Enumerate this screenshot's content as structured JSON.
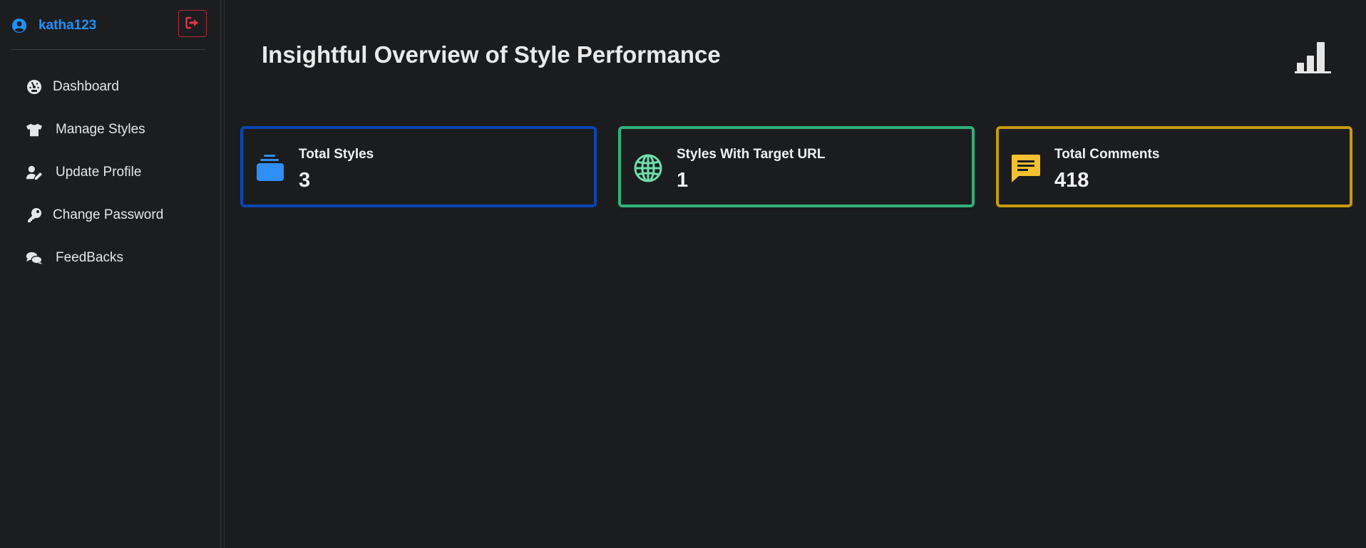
{
  "user": {
    "username": "katha123"
  },
  "sidebar": {
    "items": [
      {
        "label": "Dashboard",
        "icon": "tachometer-icon"
      },
      {
        "label": "Manage Styles",
        "icon": "tshirt-icon"
      },
      {
        "label": "Update Profile",
        "icon": "user-edit-icon"
      },
      {
        "label": "Change Password",
        "icon": "key-icon"
      },
      {
        "label": "FeedBacks",
        "icon": "comments-icon"
      }
    ]
  },
  "main": {
    "title": "Insightful Overview of Style Performance",
    "cards": [
      {
        "label": "Total Styles",
        "value": "3",
        "icon": "layers-icon",
        "color": "#0a46b5"
      },
      {
        "label": "Styles With Target URL",
        "value": "1",
        "icon": "globe-icon",
        "color": "#2fb27a"
      },
      {
        "label": "Total Comments",
        "value": "418",
        "icon": "message-icon",
        "color": "#c89a0e"
      }
    ]
  },
  "colors": {
    "accent": "#1e90ff",
    "danger": "#dc3545",
    "background": "#1b1c1e"
  }
}
